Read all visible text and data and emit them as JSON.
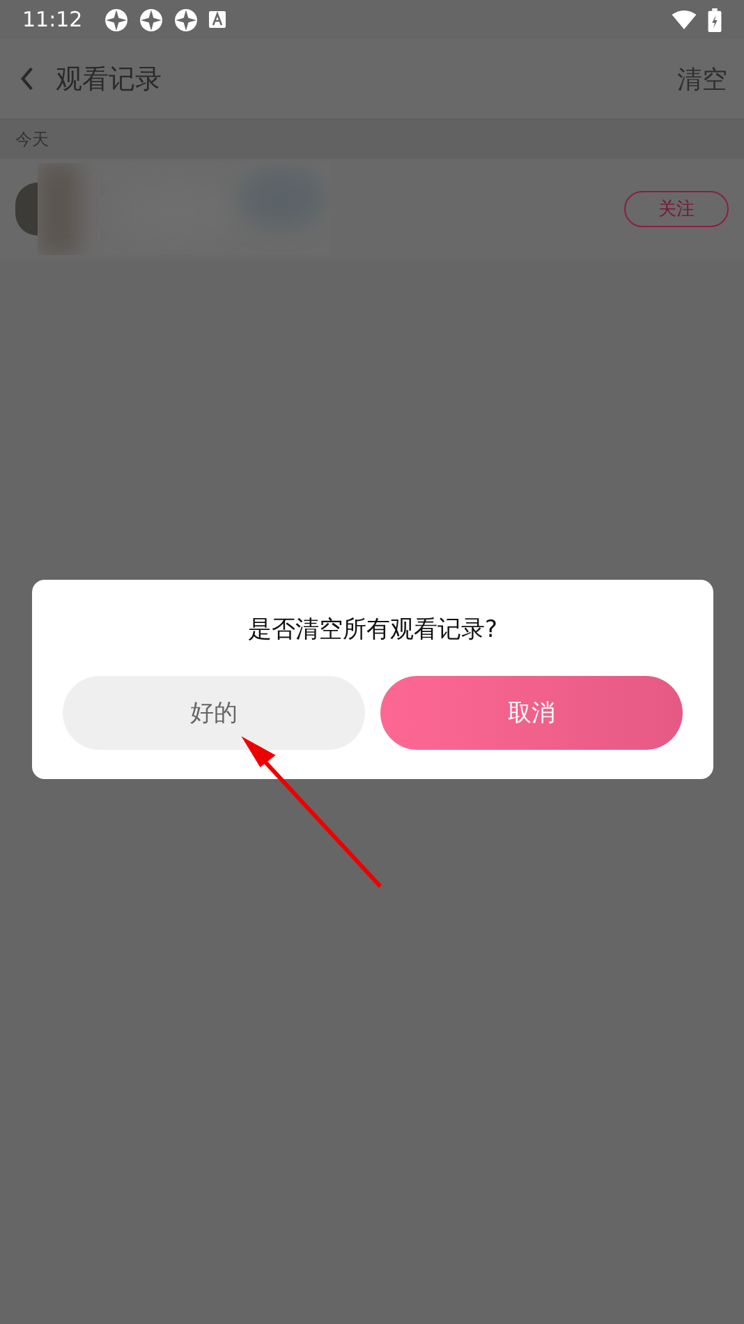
{
  "status_bar": {
    "time": "11:12"
  },
  "header": {
    "title": "观看记录",
    "action": "清空"
  },
  "section": {
    "label": "今天"
  },
  "history": [
    {
      "kind": "picture",
      "follow_label": "关注"
    }
  ],
  "dialog": {
    "message": "是否清空所有观看记录?",
    "buttons": [
      {
        "label": "好的",
        "kind": "secondary"
      },
      {
        "label": "取消",
        "kind": "primary"
      }
    ]
  }
}
